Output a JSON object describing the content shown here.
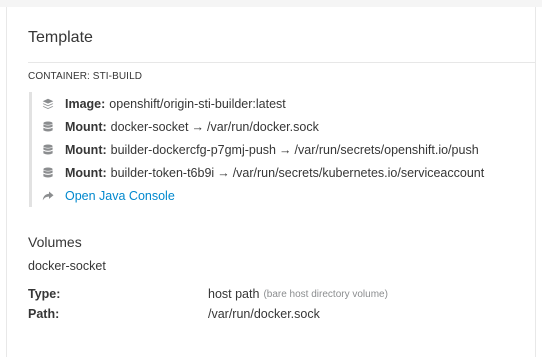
{
  "template": {
    "title": "Template",
    "container_label": "CONTAINER: STI-BUILD",
    "image": {
      "label": "Image:",
      "value": "openshift/origin-sti-builder:latest",
      "icon": "image-stack-icon"
    },
    "mounts": [
      {
        "label": "Mount:",
        "source": "docker-socket",
        "arrow": "→",
        "target": "/var/run/docker.sock",
        "icon": "database-icon"
      },
      {
        "label": "Mount:",
        "source": "builder-dockercfg-p7gmj-push",
        "arrow": "→",
        "target": "/var/run/secrets/openshift.io/push",
        "icon": "database-icon"
      },
      {
        "label": "Mount:",
        "source": "builder-token-t6b9i",
        "arrow": "→",
        "target": "/var/run/secrets/kubernetes.io/serviceaccount",
        "icon": "database-icon"
      }
    ],
    "console_link": {
      "label": "Open Java Console",
      "icon": "share-arrow-icon"
    }
  },
  "volumes": {
    "title": "Volumes",
    "name": "docker-socket",
    "type_label": "Type:",
    "type_value": "host path",
    "type_note": "(bare host directory volume)",
    "path_label": "Path:",
    "path_value": "/var/run/docker.sock"
  },
  "colors": {
    "link": "#0088ce",
    "text": "#363636",
    "muted": "#8b8d8f",
    "icon": "#8b8d8f"
  }
}
